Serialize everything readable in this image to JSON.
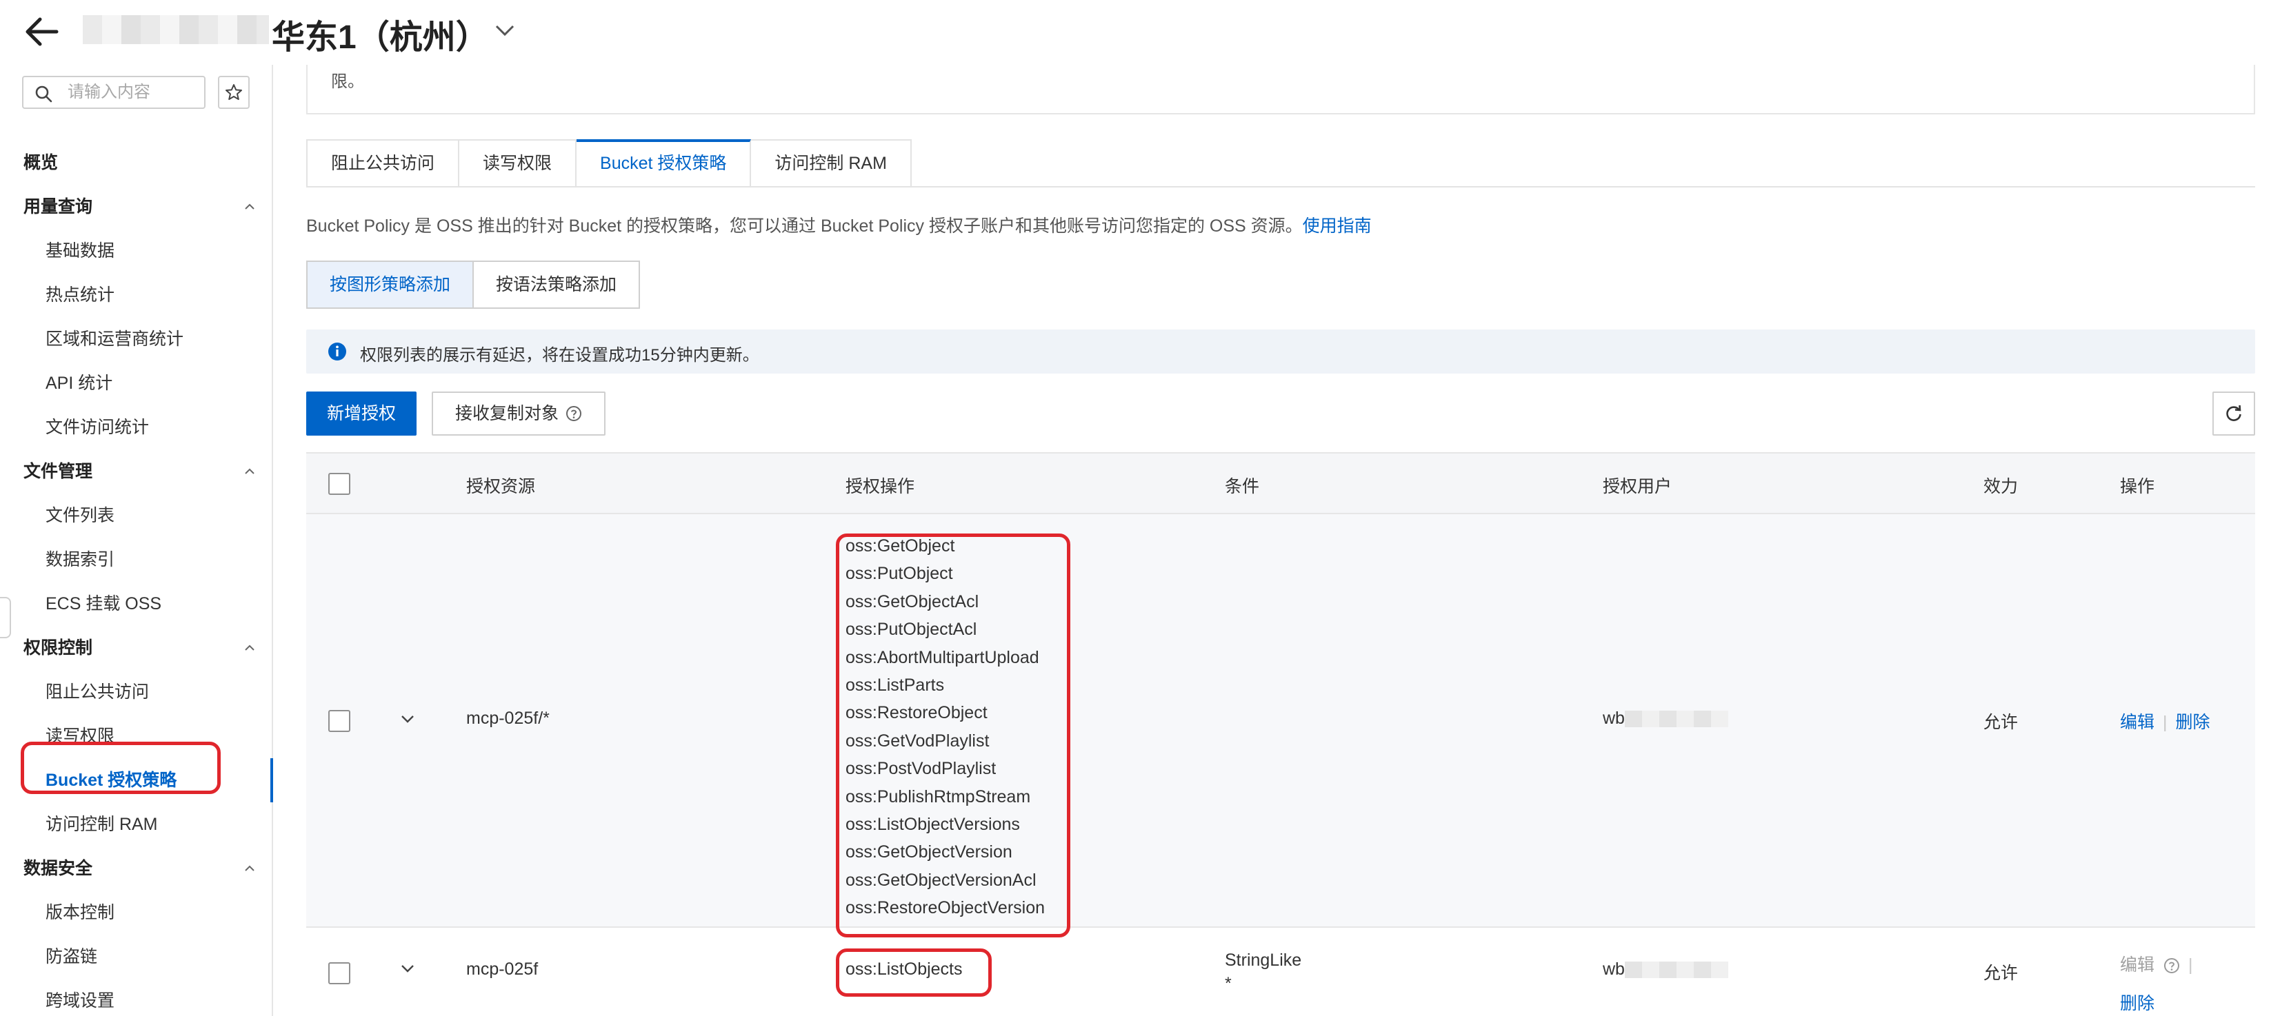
{
  "header": {
    "region_title": "华东1（杭州）"
  },
  "sidebar": {
    "search_placeholder": "请输入内容",
    "overview": "概览",
    "groups": [
      {
        "label": "用量查询",
        "items": [
          "基础数据",
          "热点统计",
          "区域和运营商统计",
          "API 统计",
          "文件访问统计"
        ]
      },
      {
        "label": "文件管理",
        "items": [
          "文件列表",
          "数据索引",
          "ECS 挂载 OSS"
        ]
      },
      {
        "label": "权限控制",
        "items": [
          "阻止公共访问",
          "读写权限",
          "Bucket 授权策略",
          "访问控制 RAM"
        ]
      },
      {
        "label": "数据安全",
        "items": [
          "版本控制",
          "防盗链",
          "跨域设置"
        ]
      }
    ],
    "active_item": "Bucket 授权策略"
  },
  "main": {
    "intro_tail": "限。",
    "tabs": [
      "阻止公共访问",
      "读写权限",
      "Bucket 授权策略",
      "访问控制 RAM"
    ],
    "active_tab": "Bucket 授权策略",
    "description": "Bucket Policy 是 OSS 推出的针对 Bucket 的授权策略，您可以通过 Bucket Policy 授权子账户和其他账号访问您指定的 OSS 资源。",
    "description_link": "使用指南",
    "mode_buttons": [
      "按图形策略添加",
      "按语法策略添加"
    ],
    "active_mode": "按图形策略添加",
    "notice": "权限列表的展示有延迟，将在设置成功15分钟内更新。",
    "add_button": "新增授权",
    "receive_button": "接收复制对象"
  },
  "table": {
    "headers": [
      "授权资源",
      "授权操作",
      "条件",
      "授权用户",
      "效力",
      "操作"
    ],
    "rows": [
      {
        "resource": "mcp-025f/*",
        "actions": [
          "oss:GetObject",
          "oss:PutObject",
          "oss:GetObjectAcl",
          "oss:PutObjectAcl",
          "oss:AbortMultipartUpload",
          "oss:ListParts",
          "oss:RestoreObject",
          "oss:GetVodPlaylist",
          "oss:PostVodPlaylist",
          "oss:PublishRtmpStream",
          "oss:ListObjectVersions",
          "oss:GetObjectVersion",
          "oss:GetObjectVersionAcl",
          "oss:RestoreObjectVersion"
        ],
        "condition": "",
        "user_prefix": "wb",
        "effect": "允许",
        "edit": "编辑",
        "delete": "删除"
      },
      {
        "resource": "mcp-025f",
        "actions": [
          "oss:ListObjects"
        ],
        "condition": "StringLike",
        "condition_value": "*",
        "user_prefix": "wb",
        "effect": "允许",
        "edit": "编辑",
        "delete": "删除"
      }
    ]
  },
  "colors": {
    "primary": "#0064c8",
    "highlight": "#e0262c",
    "notice_bg": "#eff3f8"
  }
}
